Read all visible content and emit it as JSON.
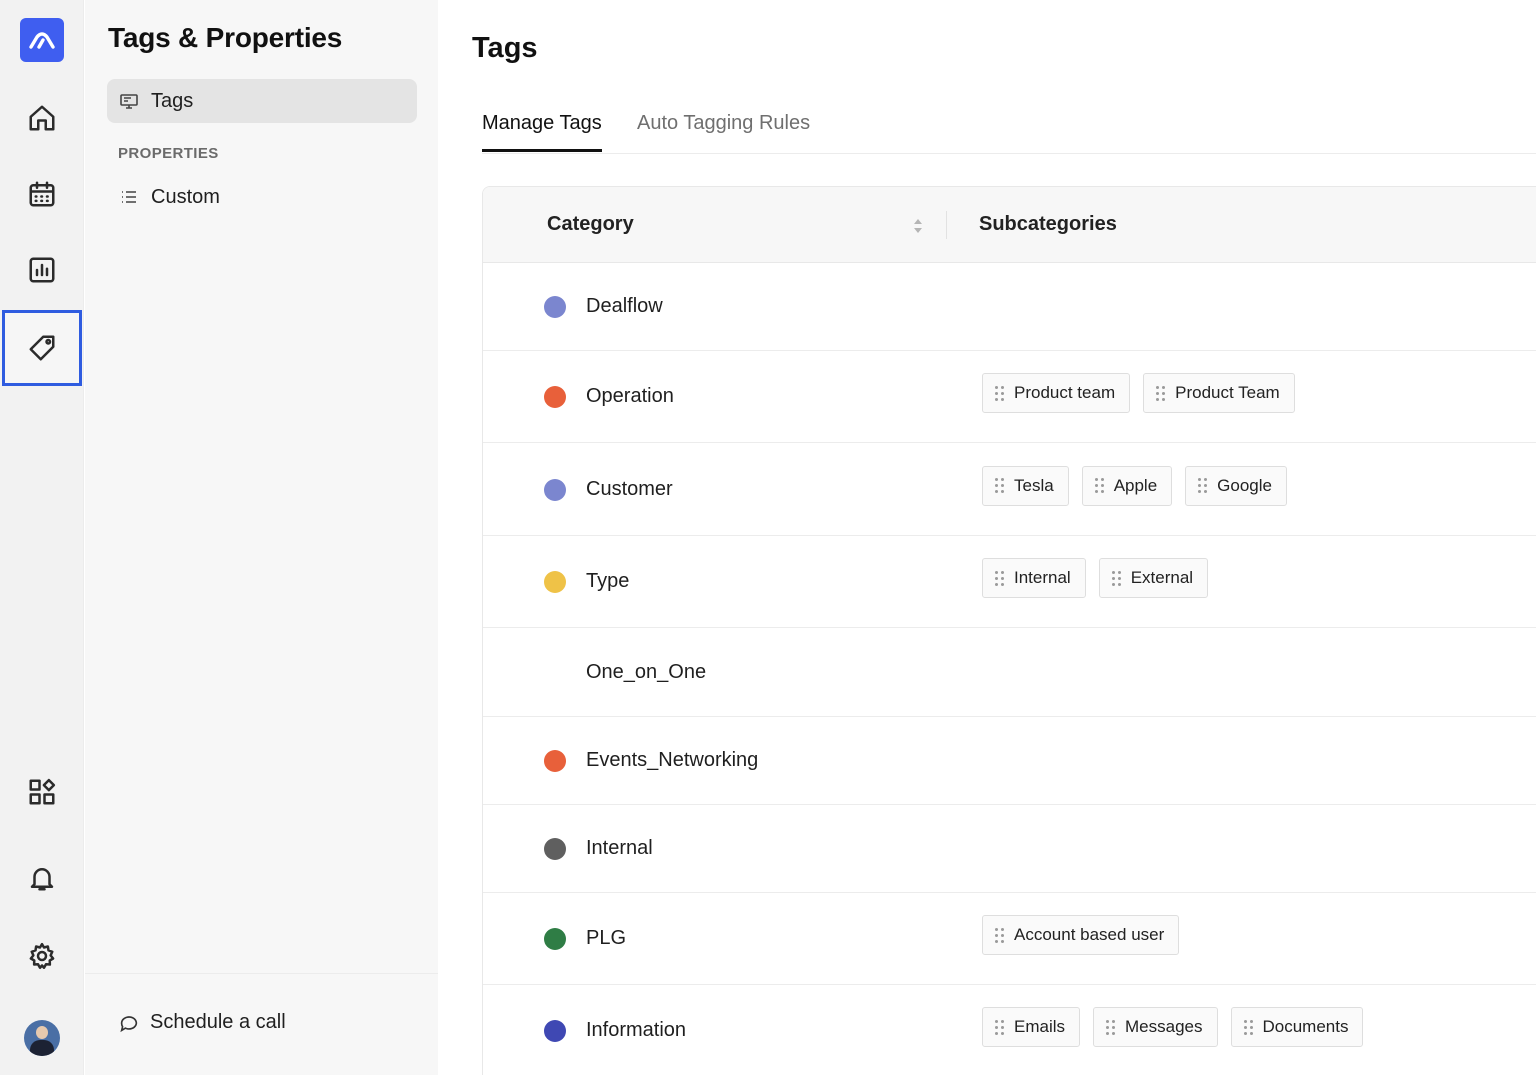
{
  "sidebar": {
    "title": "Tags & Properties",
    "items": [
      {
        "label": "Tags",
        "icon": "monitor-icon",
        "selected": true
      }
    ],
    "section_label": "PROPERTIES",
    "properties": [
      {
        "label": "Custom",
        "icon": "list-icon"
      }
    ],
    "footer": {
      "label": "Schedule a call",
      "icon": "chat-bubble-icon"
    }
  },
  "rail": {
    "icons": [
      "logo-icon",
      "home-icon",
      "calendar-icon",
      "chart-icon",
      "tag-icon",
      "widgets-icon",
      "bell-icon",
      "gear-icon",
      "avatar"
    ],
    "active": "tag-icon",
    "accent": "#2f5ce0",
    "logo_color": "#3f5ef0"
  },
  "main": {
    "title": "Tags",
    "tabs": [
      {
        "label": "Manage Tags",
        "active": true
      },
      {
        "label": "Auto Tagging Rules",
        "active": false
      }
    ],
    "table": {
      "columns": [
        "Category",
        "Subcategories"
      ],
      "rows": [
        {
          "category": "Dealflow",
          "color": "#7b86cf",
          "subcategories": []
        },
        {
          "category": "Operation",
          "color": "#e8603a",
          "subcategories": [
            "Product team",
            "Product Team"
          ]
        },
        {
          "category": "Customer",
          "color": "#7b86cf",
          "subcategories": [
            "Tesla",
            "Apple",
            "Google"
          ]
        },
        {
          "category": "Type",
          "color": "#efc247",
          "subcategories": [
            "Internal",
            "External"
          ]
        },
        {
          "category": "One_on_One",
          "color": null,
          "subcategories": []
        },
        {
          "category": "Events_Networking",
          "color": "#e8603a",
          "subcategories": []
        },
        {
          "category": "Internal",
          "color": "#5f5f5f",
          "subcategories": []
        },
        {
          "category": "PLG",
          "color": "#2f7d45",
          "subcategories": [
            "Account based user"
          ]
        },
        {
          "category": "Information",
          "color": "#3f48b3",
          "subcategories": [
            "Emails",
            "Messages",
            "Documents"
          ]
        }
      ]
    }
  }
}
